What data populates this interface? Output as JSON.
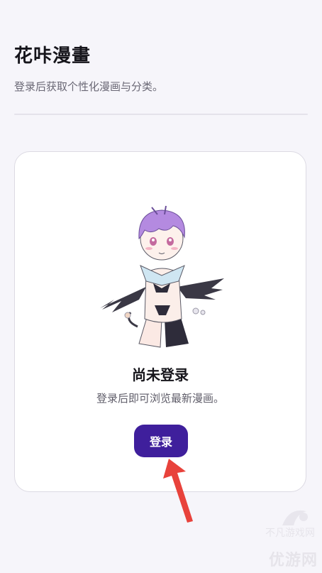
{
  "header": {
    "title": "花咔漫畫",
    "subtitle": "登录后获取个性化漫画与分类。"
  },
  "empty_state": {
    "title": "尚未登录",
    "description": "登录后即可浏览最新漫画。",
    "illustration_icon": "mascot-illustration"
  },
  "login_button": {
    "label": "登录",
    "color": "#3f1f9c"
  },
  "annotation": {
    "arrow_color": "#e8423b"
  },
  "watermark": {
    "top_text": "不凡游戏网",
    "bottom_text": "优游网"
  },
  "colors": {
    "background": "#f6f5fa",
    "card": "#ffffff",
    "accent": "#3f1f9c"
  }
}
